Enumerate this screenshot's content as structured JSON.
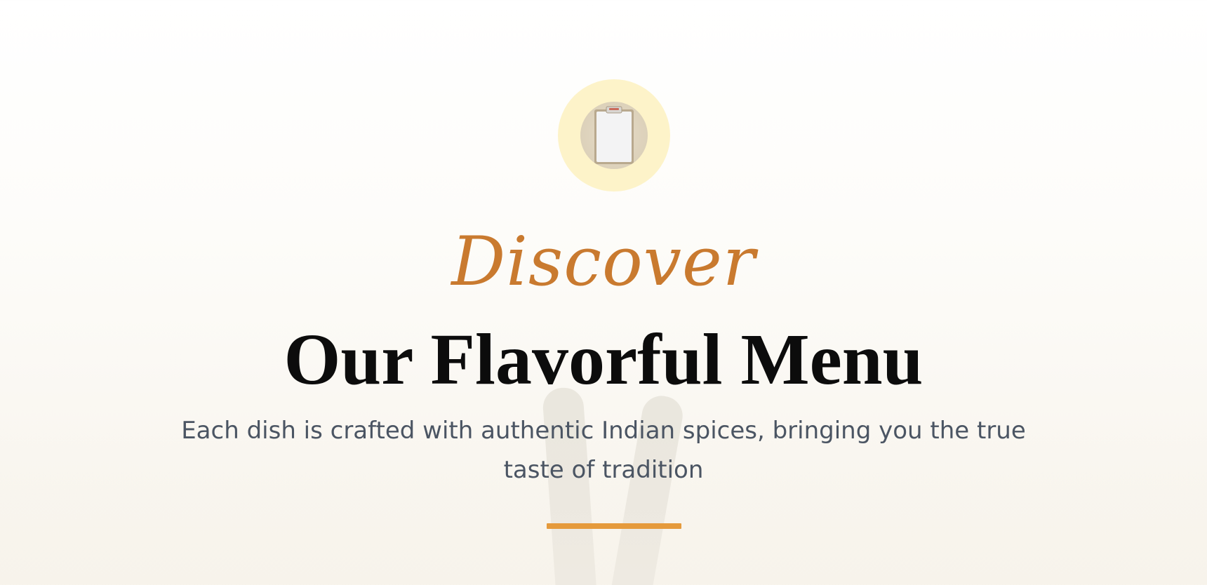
{
  "section": {
    "badge": {
      "icon": "clipboard-icon",
      "ring_color": "#fdf3c9"
    },
    "eyebrow": "Discover",
    "title": "Our Flavorful Menu",
    "subtitle": "Each dish is crafted with authentic Indian spices, bringing you the true taste of tradition",
    "colors": {
      "accent": "#c97a2f",
      "divider": "#e59a3c",
      "title": "#0c0c0c",
      "subtitle": "#4b5563"
    }
  }
}
